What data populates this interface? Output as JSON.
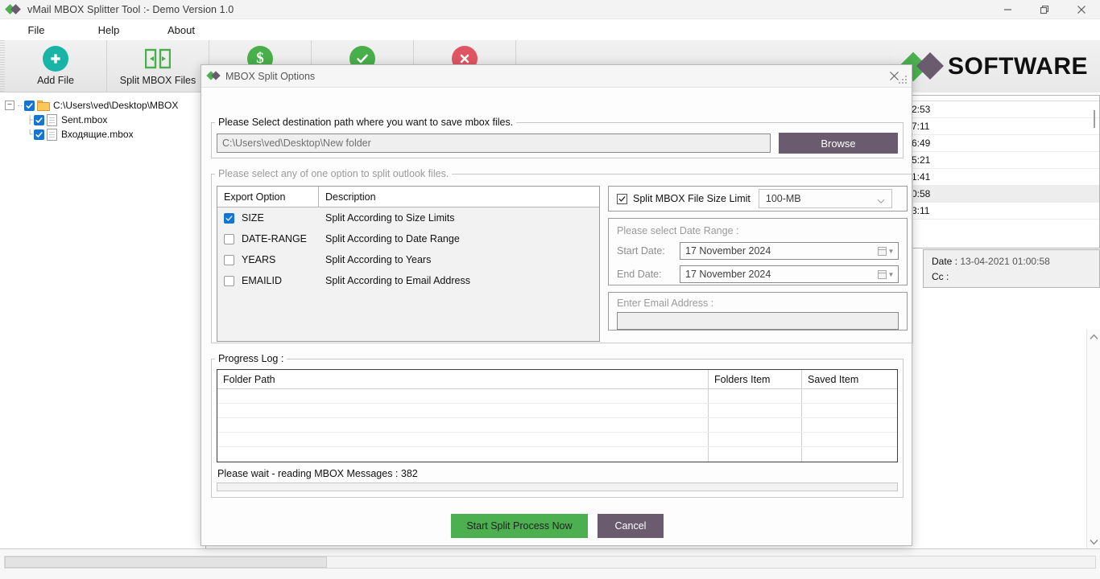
{
  "window": {
    "title": "vMail MBOX Splitter Tool  :- Demo Version 1.0",
    "minimize_label": "Minimize",
    "restore_label": "Restore",
    "close_label": "Close"
  },
  "menu": [
    {
      "label": "File"
    },
    {
      "label": "Help"
    },
    {
      "label": "About"
    }
  ],
  "toolbar": [
    {
      "label": "Add File",
      "icon": "plus-circle-icon",
      "color": "#18b5a7"
    },
    {
      "label": "Split MBOX Files",
      "icon": "split-icon",
      "color": "#49af4b"
    },
    {
      "label": "",
      "icon": "dollar-circle-icon",
      "color": "#49af4b"
    },
    {
      "label": "",
      "icon": "check-circle-icon",
      "color": "#49af4b"
    },
    {
      "label": "",
      "icon": "close-circle-icon",
      "color": "#e05563"
    }
  ],
  "branding": {
    "logo_text": "SOFTWARE"
  },
  "tree": [
    {
      "label": "C:\\Users\\ved\\Desktop\\MBOX",
      "level": 1,
      "checked": true,
      "icon": "folder-icon"
    },
    {
      "label": "Sent.mbox",
      "level": 2,
      "checked": true,
      "icon": "file-icon"
    },
    {
      "label": "Входящие.mbox",
      "level": 2,
      "checked": true,
      "icon": "file-icon"
    }
  ],
  "mail_list": [
    {
      "time": "2:53",
      "selected": false
    },
    {
      "time": "7:11",
      "selected": false
    },
    {
      "time": "6:49",
      "selected": false
    },
    {
      "time": "5:21",
      "selected": false
    },
    {
      "time": "1:41",
      "selected": false
    },
    {
      "time": "0:58",
      "selected": true
    },
    {
      "time": "3:11",
      "selected": false
    }
  ],
  "mail_detail": {
    "date_label": "Date :",
    "date_value": "13-04-2021 01:00:58",
    "cc_label": "Cc :",
    "cc_value": ""
  },
  "dialog": {
    "title": "MBOX Split Options",
    "close_label": "Close",
    "destination": {
      "legend": "Please Select destination path where you want to save mbox files.",
      "path_value": "C:\\Users\\ved\\Desktop\\New folder",
      "browse_label": "Browse"
    },
    "options": {
      "legend": "Please select any of one option to split outlook files.",
      "columns": [
        "Export Option",
        "Description"
      ],
      "rows": [
        {
          "name": "SIZE",
          "description": "Split According to Size Limits",
          "checked": true
        },
        {
          "name": "DATE-RANGE",
          "description": "Split According to Date Range",
          "checked": false
        },
        {
          "name": "YEARS",
          "description": "Split According to Years",
          "checked": false
        },
        {
          "name": "EMAILID",
          "description": "Split According to Email Address",
          "checked": false
        }
      ]
    },
    "size_limit": {
      "checkbox_label": "Split MBOX File Size Limit",
      "checked": true,
      "selected_value": "100-MB"
    },
    "date_range": {
      "title": "Please select Date Range :",
      "start_label": "Start Date:",
      "start_value": "17  November  2024",
      "end_label": "End Date:",
      "end_value": "17  November  2024",
      "enabled": false
    },
    "email": {
      "title": "Enter Email Address :",
      "value": "",
      "enabled": false
    },
    "progress_log": {
      "legend": "Progress Log :",
      "columns": [
        "Folder Path",
        "Folders Item",
        "Saved Item"
      ],
      "rows": [],
      "empty_row_count": 5,
      "status_text": "Please wait - reading MBOX Messages : 382",
      "progress_percent": 0
    },
    "actions": {
      "start_label": "Start Split Process Now",
      "cancel_label": "Cancel",
      "start_color": "#4caf50",
      "cancel_color": "#6b5b6e"
    }
  }
}
